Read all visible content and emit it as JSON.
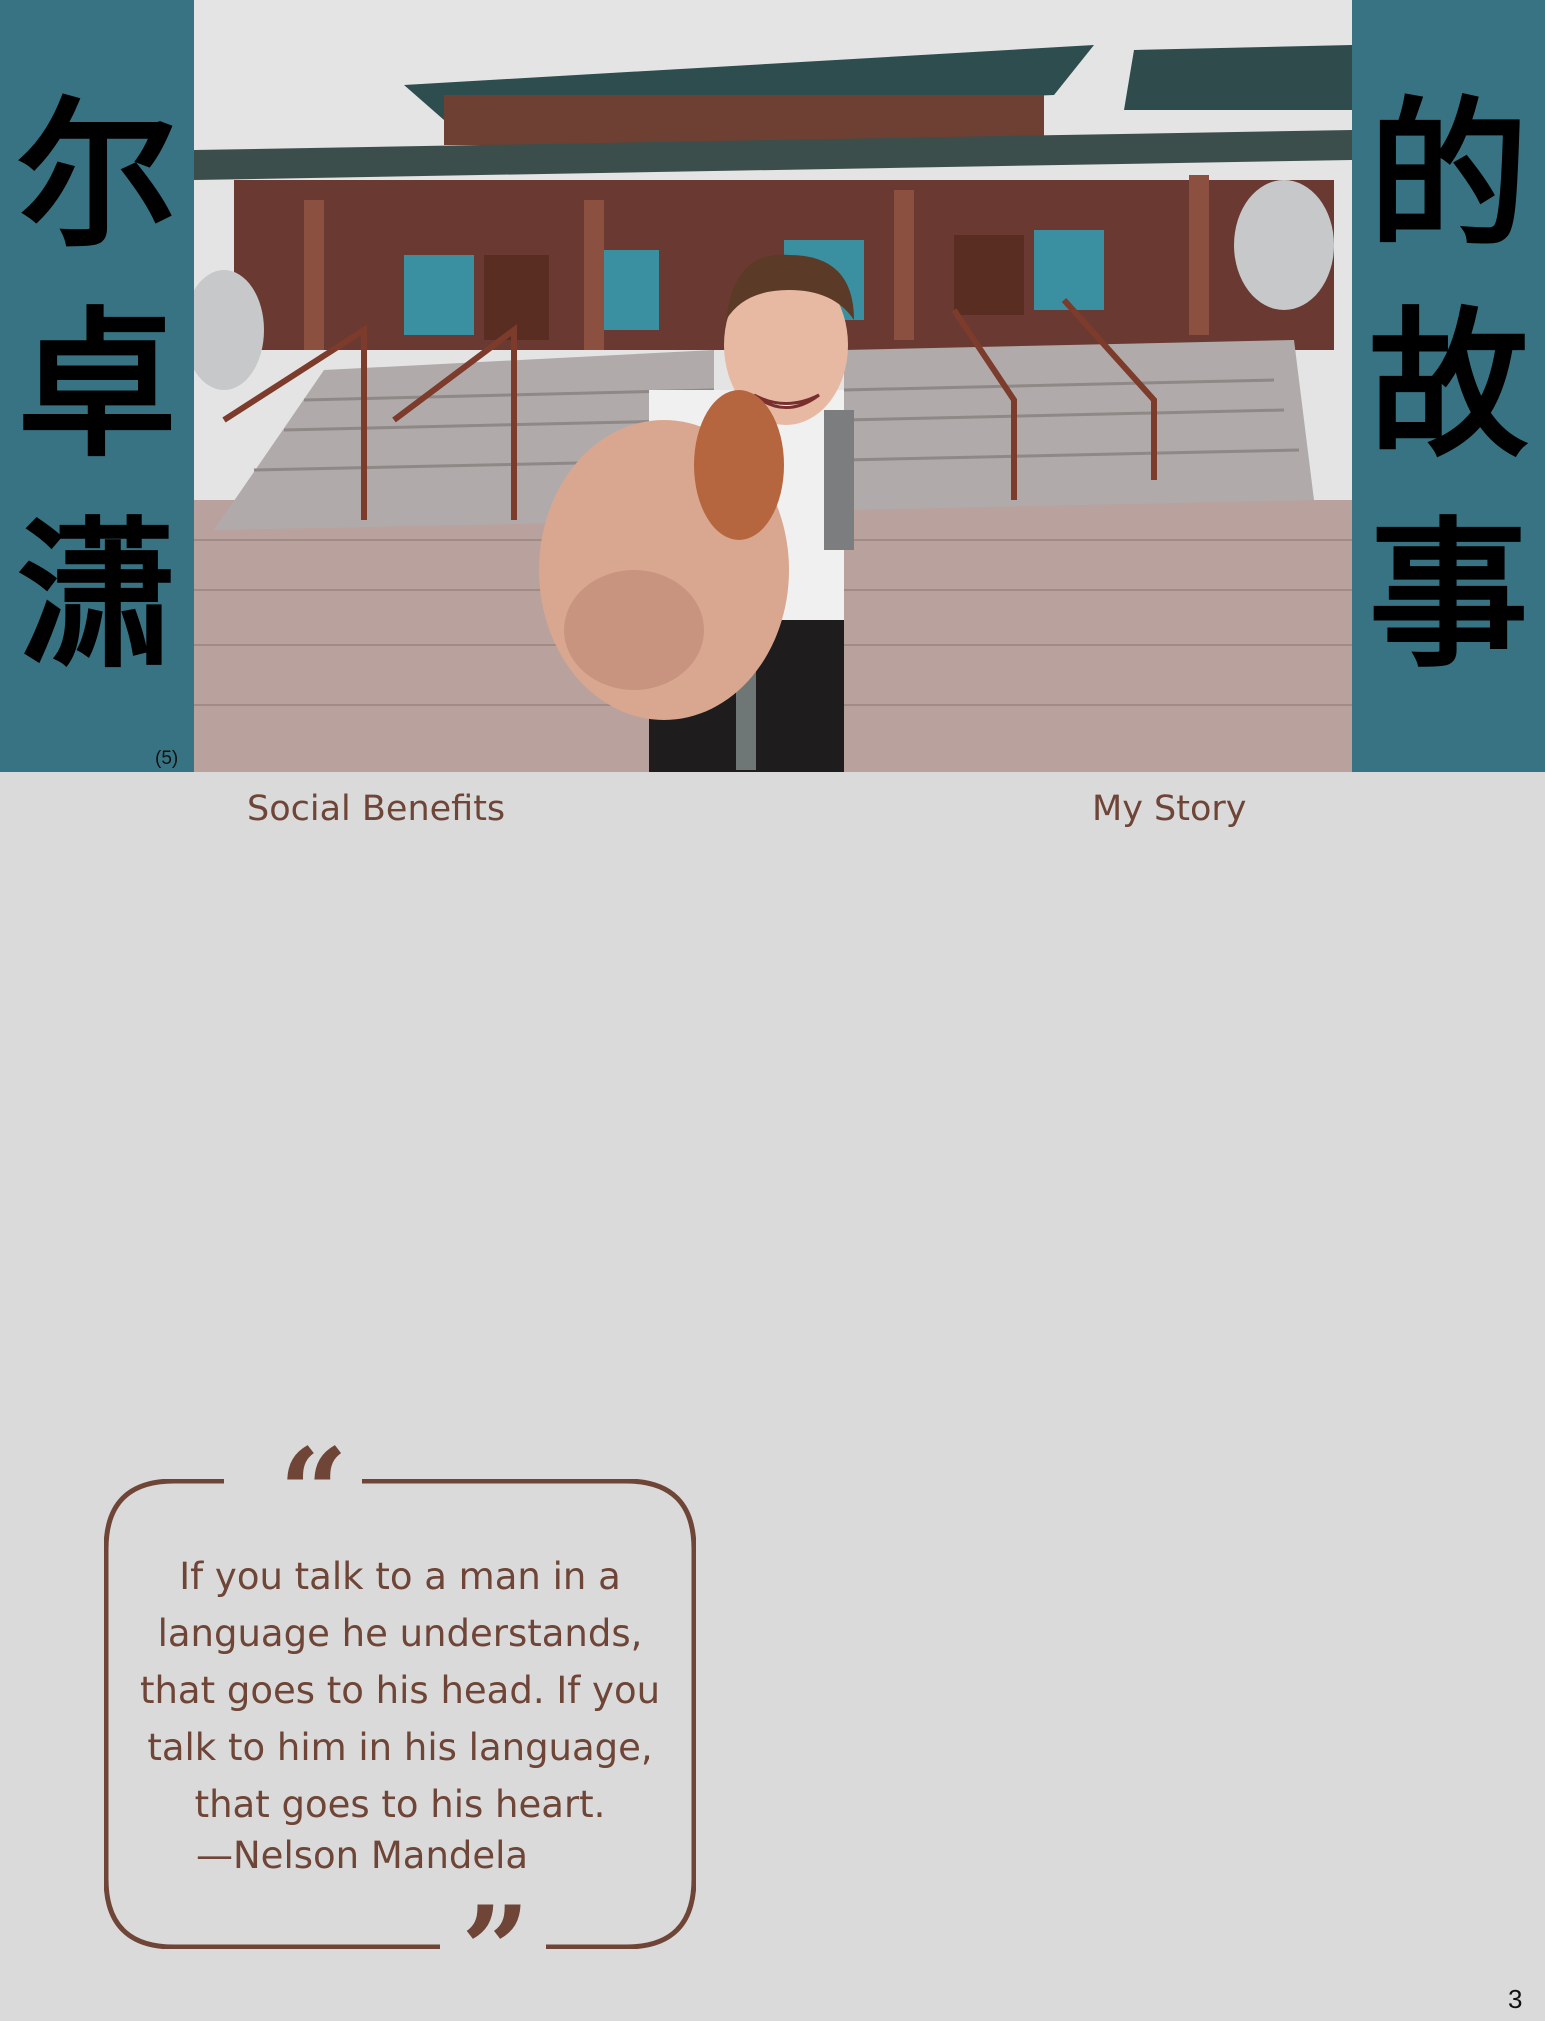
{
  "left_band": {
    "chars": [
      "尔",
      "卓",
      "潇"
    ]
  },
  "right_band": {
    "chars": [
      "的",
      "故",
      "事"
    ]
  },
  "figure_ref": "(5)",
  "photo": {
    "alt": "photo"
  },
  "captions": {
    "left": "Social Benefits",
    "right": "My Story"
  },
  "quote": {
    "open_mark": "“",
    "close_mark": "”",
    "text": "If you talk to a man in a language he understands, that goes to his head. If you talk to him in his language, that goes to his heart.",
    "author": "—Nelson Mandela"
  },
  "page_number": "3",
  "colors": {
    "band": "#387383",
    "text_brown": "#6e4536",
    "background": "#dbdada"
  }
}
